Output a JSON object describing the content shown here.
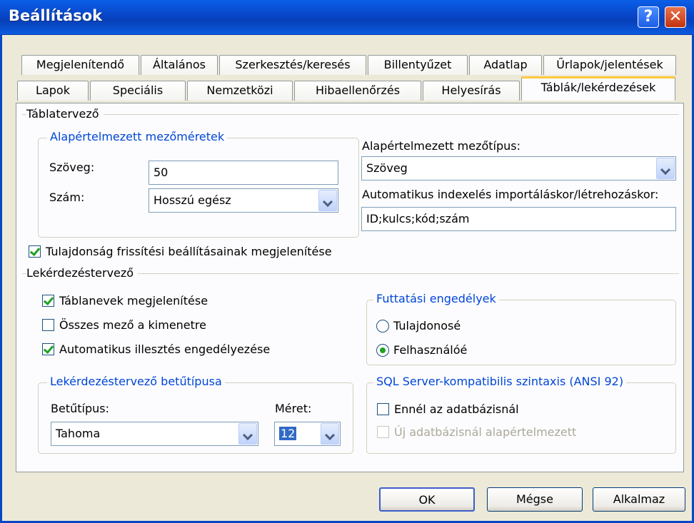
{
  "window": {
    "title": "Beállítások",
    "help_glyph": "?",
    "close_glyph": "✕"
  },
  "tabs_row1": [
    "Megjelenítendő",
    "Általános",
    "Szerkesztés/keresés",
    "Billentyűzet",
    "Adatlap",
    "Űrlapok/jelentések"
  ],
  "tabs_row2": [
    "Lapok",
    "Speciális",
    "Nemzetközi",
    "Hibaellenőrzés",
    "Helyesírás",
    "Táblák/lekérdezések"
  ],
  "active_tab": "Táblák/lekérdezések",
  "table_designer": {
    "section_label": "Táblatervező",
    "field_sizes": {
      "group_label": "Alapértelmezett mezőméretek",
      "text_label": "Szöveg:",
      "text_value": "50",
      "number_label": "Szám:",
      "number_value": "Hosszú egész"
    },
    "default_field_type": {
      "label": "Alapértelmezett mezőtípus:",
      "value": "Szöveg"
    },
    "autoindex": {
      "label": "Automatikus indexelés importáláskor/létrehozáskor:",
      "value": "ID;kulcs;kód;szám"
    },
    "show_property_update": {
      "label": "Tulajdonság frissítési beállításainak megjelenítése",
      "checked": true
    }
  },
  "query_designer": {
    "section_label": "Lekérdezéstervező",
    "show_table_names": {
      "label": "Táblanevek megjelenítése",
      "checked": true
    },
    "output_all_fields": {
      "label": "Összes mező a kimenetre",
      "checked": false
    },
    "enable_autojoin": {
      "label": "Automatikus illesztés engedélyezése",
      "checked": true
    },
    "run_permissions": {
      "group_label": "Futtatási engedélyek",
      "owner": {
        "label": "Tulajdonosé",
        "checked": false
      },
      "user": {
        "label": "Felhasználóé",
        "checked": true
      }
    },
    "font": {
      "group_label": "Lekérdezéstervező betűtípusa",
      "font_label": "Betűtípus:",
      "font_value": "Tahoma",
      "size_label": "Méret:",
      "size_value": "12"
    },
    "sql_server": {
      "group_label": "SQL Server-kompatibilis szintaxis (ANSI 92)",
      "this_db": {
        "label": "Ennél az adatbázisnál",
        "checked": false
      },
      "new_db_default": {
        "label": "Új adatbázisnál alapértelmezett",
        "checked": false,
        "disabled": true
      }
    }
  },
  "buttons": {
    "ok": "OK",
    "cancel": "Mégse",
    "apply": "Alkalmaz"
  },
  "colors": {
    "titlebar": "#0846C8",
    "group_label": "#0046D5",
    "check": "#21A121",
    "dialog_bg": "#ECE9D8"
  },
  "icons": [
    "help-icon",
    "close-icon",
    "chevron-down-icon",
    "checkmark-icon",
    "radio-dot-icon"
  ]
}
